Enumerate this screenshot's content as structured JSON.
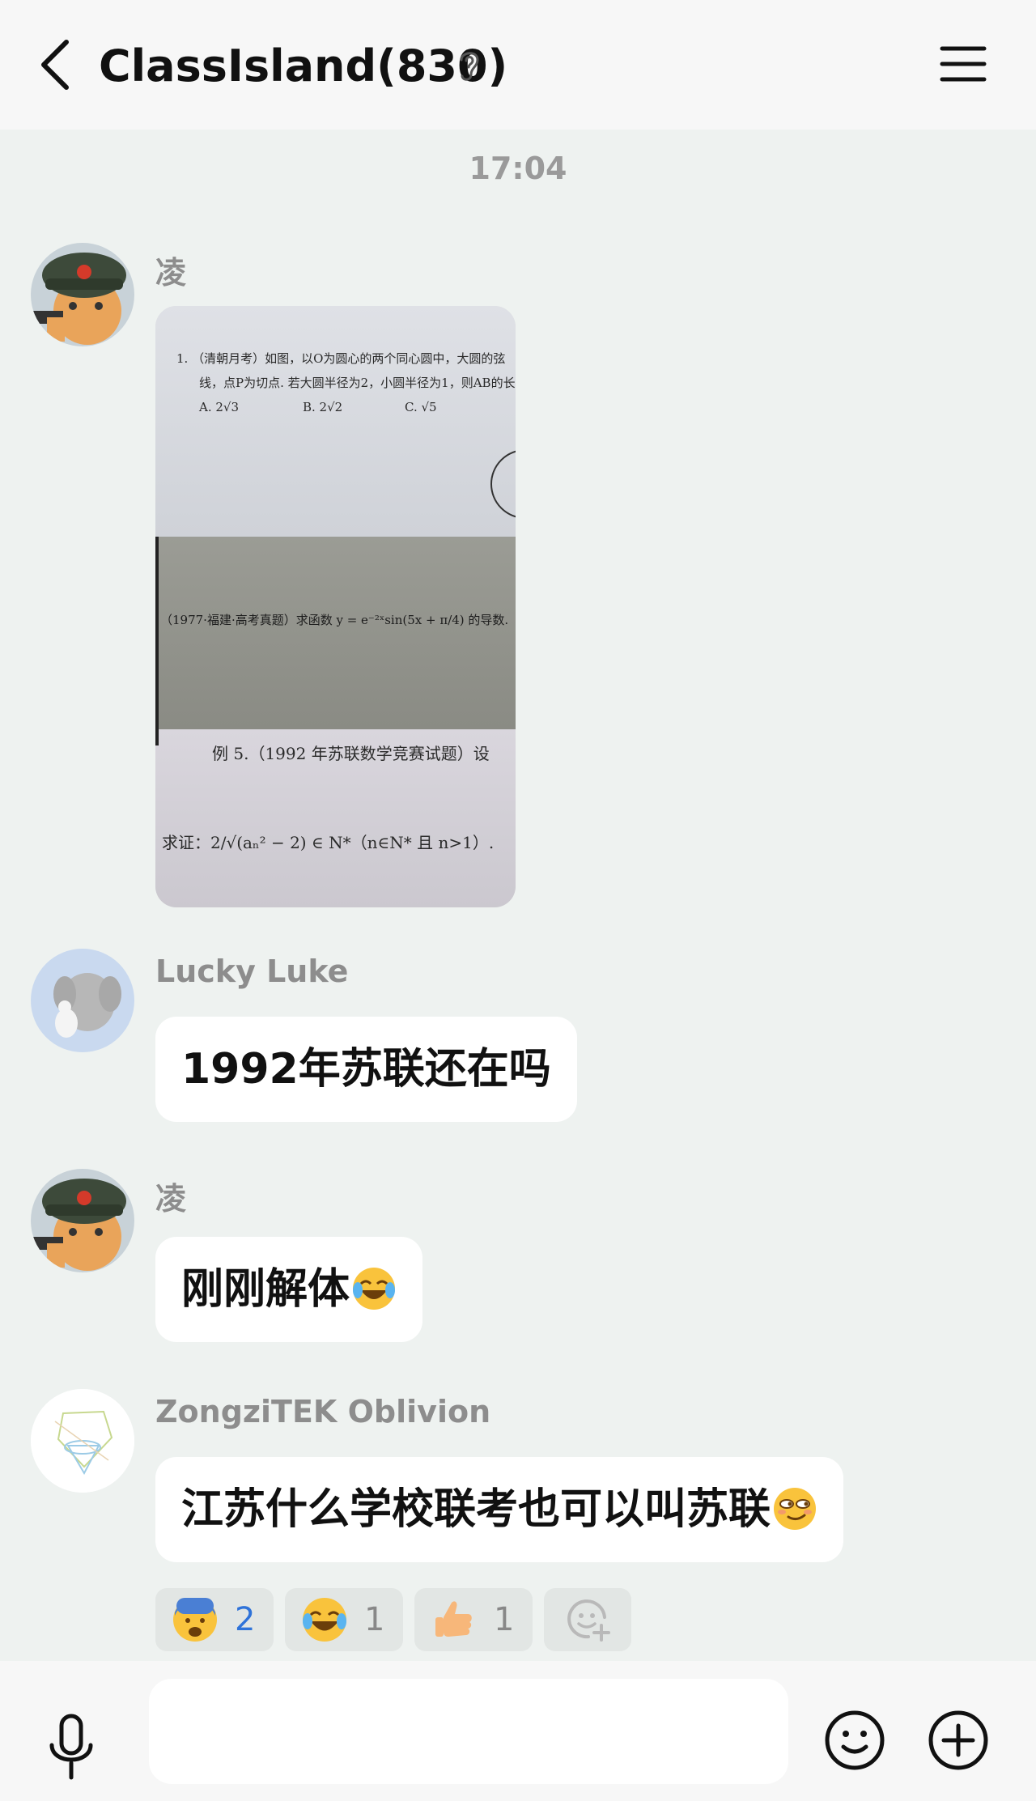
{
  "header": {
    "title": "ClassIsland(830)",
    "icons": [
      "back-arrow-icon",
      "ear-icon",
      "menu-icon"
    ]
  },
  "timestamp": "17:04",
  "messages": [
    {
      "sender": "凌",
      "type": "image",
      "image_text": {
        "line1": "1. （清朝月考）如图，以O为圆心的两个同心圆中，大圆的弦",
        "line2": "线，点P为切点. 若大圆半径为2，小圆半径为1，则AB的长",
        "optA": "A. 2√3",
        "optB": "B. 2√2",
        "optC": "C. √5",
        "line3": "（1977·福建·高考真题）求函数 y = e⁻²ˣsin(5x + π/4) 的导数.",
        "line4": "例 5.（1992 年苏联数学竞赛试题）设",
        "line5": "求证：2/√(aₙ² − 2) ∈ N*（n∈N* 且 n>1）."
      }
    },
    {
      "sender": "Lucky Luke",
      "type": "text",
      "text": "1992年苏联还在吗"
    },
    {
      "sender": "凌",
      "type": "text",
      "text": "刚刚解体",
      "emoji": "joy-tears"
    },
    {
      "sender": "ZongziTEK Oblivion",
      "type": "text",
      "text": "江苏什么学校联考也可以叫苏联",
      "emoji": "smirk"
    }
  ],
  "reactions": [
    {
      "emoji": "fearful-face",
      "count": "2"
    },
    {
      "emoji": "joy-tears",
      "count": "1"
    },
    {
      "emoji": "thumbs-up",
      "count": "1"
    },
    {
      "emoji": "add-reaction"
    }
  ],
  "input": {
    "placeholder": "",
    "icons": [
      "microphone-icon",
      "emoji-icon",
      "plus-icon"
    ]
  },
  "colors": {
    "background": "#eef2f0",
    "header": "#f7f7f7",
    "bubble": "#ffffff",
    "reaction_count_active": "#2f73d9"
  }
}
